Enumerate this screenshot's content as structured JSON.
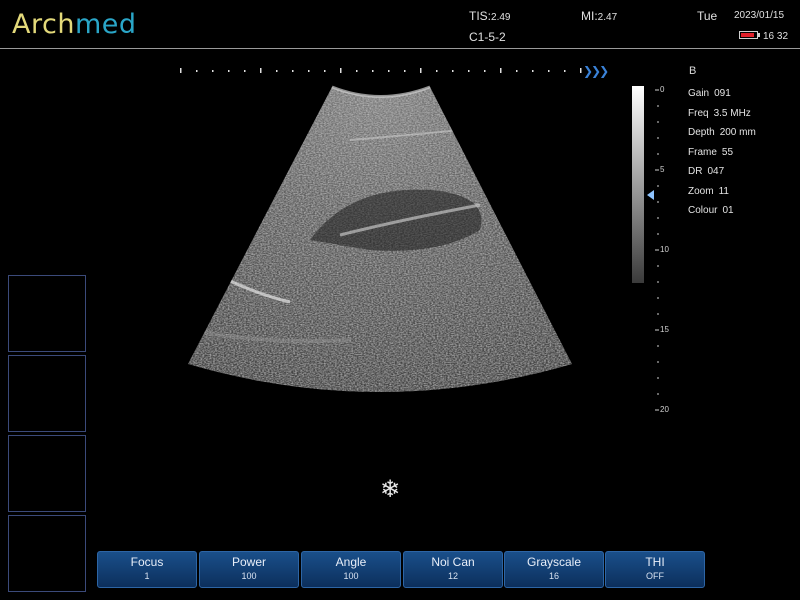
{
  "brand": {
    "part1": "Arch",
    "part2": "med"
  },
  "header": {
    "tis_label": "TIS:",
    "tis_value": "2.49",
    "mi_label": "MI:",
    "mi_value": "2.47",
    "probe": "C1-5-2",
    "day": "Tue",
    "date": "2023/01/15",
    "time": "16 32",
    "battery_level": 0.85,
    "battery_color": "#e0202a"
  },
  "mode": "B",
  "params": [
    {
      "label": "Gain",
      "value": "091"
    },
    {
      "label": "Freq",
      "value": "3.5 MHz"
    },
    {
      "label": "Depth",
      "value": "200 mm"
    },
    {
      "label": "Frame",
      "value": "55"
    },
    {
      "label": "DR",
      "value": "047"
    },
    {
      "label": "Zoom",
      "value": "11"
    },
    {
      "label": "Colour",
      "value": "01"
    }
  ],
  "depth_scale": [
    "0",
    "5",
    "10",
    "15",
    "20"
  ],
  "freeze_icon": "snowflake-icon",
  "buttons": [
    {
      "label": "Focus",
      "value": "1"
    },
    {
      "label": "Power",
      "value": "100"
    },
    {
      "label": "Angle",
      "value": "100"
    },
    {
      "label": "Noi Can",
      "value": "12"
    },
    {
      "label": "Grayscale",
      "value": "16"
    },
    {
      "label": "THI",
      "value": "OFF"
    }
  ],
  "colors": {
    "accent": "#2aa6c8",
    "logo_primary": "#e3d97a",
    "button": "#1a4f8a"
  }
}
